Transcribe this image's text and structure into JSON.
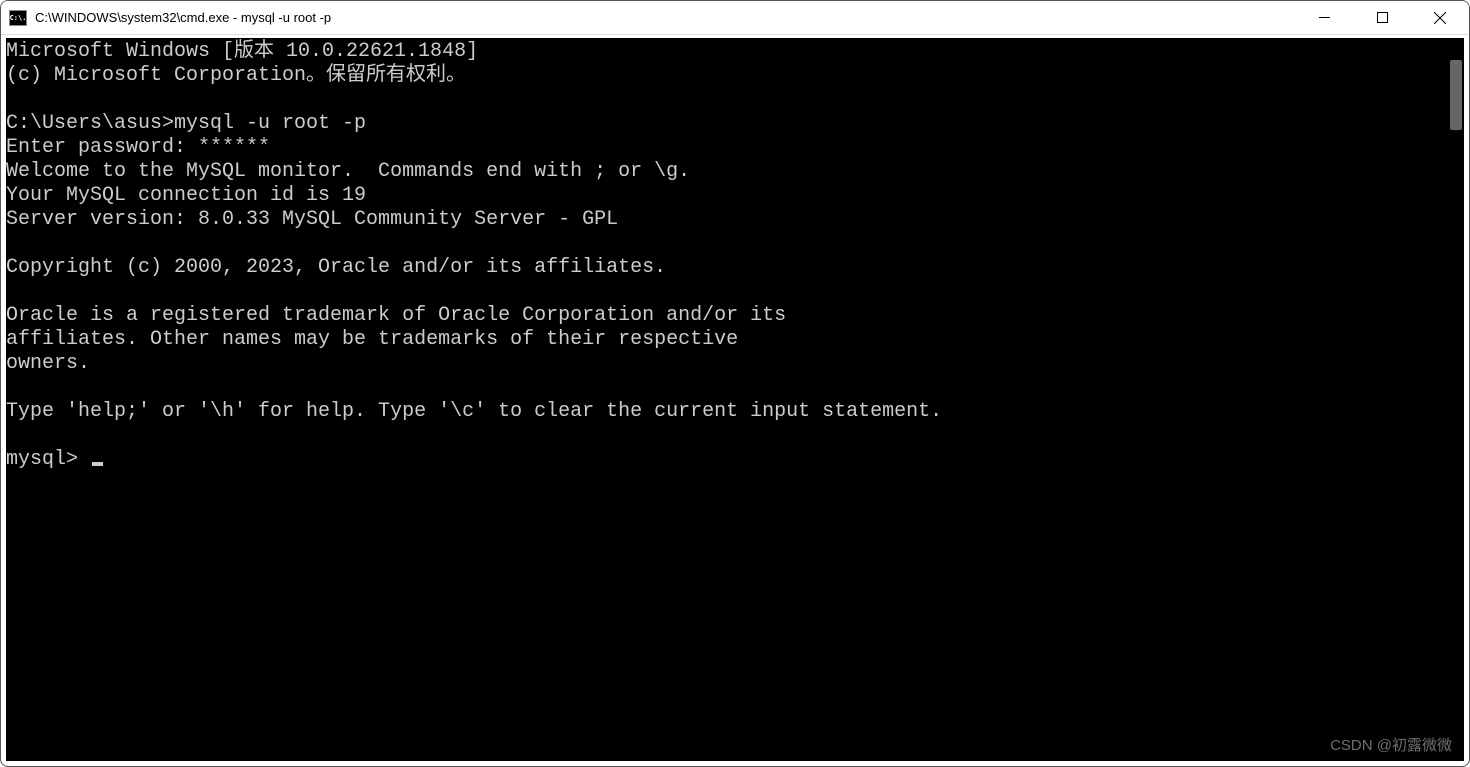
{
  "window": {
    "title": "C:\\WINDOWS\\system32\\cmd.exe - mysql  -u root -p",
    "icon_label": "C:\\."
  },
  "terminal": {
    "lines": [
      "Microsoft Windows [版本 10.0.22621.1848]",
      "(c) Microsoft Corporation。保留所有权利。",
      "",
      "C:\\Users\\asus>mysql -u root -p",
      "Enter password: ******",
      "Welcome to the MySQL monitor.  Commands end with ; or \\g.",
      "Your MySQL connection id is 19",
      "Server version: 8.0.33 MySQL Community Server - GPL",
      "",
      "Copyright (c) 2000, 2023, Oracle and/or its affiliates.",
      "",
      "Oracle is a registered trademark of Oracle Corporation and/or its",
      "affiliates. Other names may be trademarks of their respective",
      "owners.",
      "",
      "Type 'help;' or '\\h' for help. Type '\\c' to clear the current input statement.",
      ""
    ],
    "prompt": "mysql> "
  },
  "watermark": "CSDN @初露微微"
}
